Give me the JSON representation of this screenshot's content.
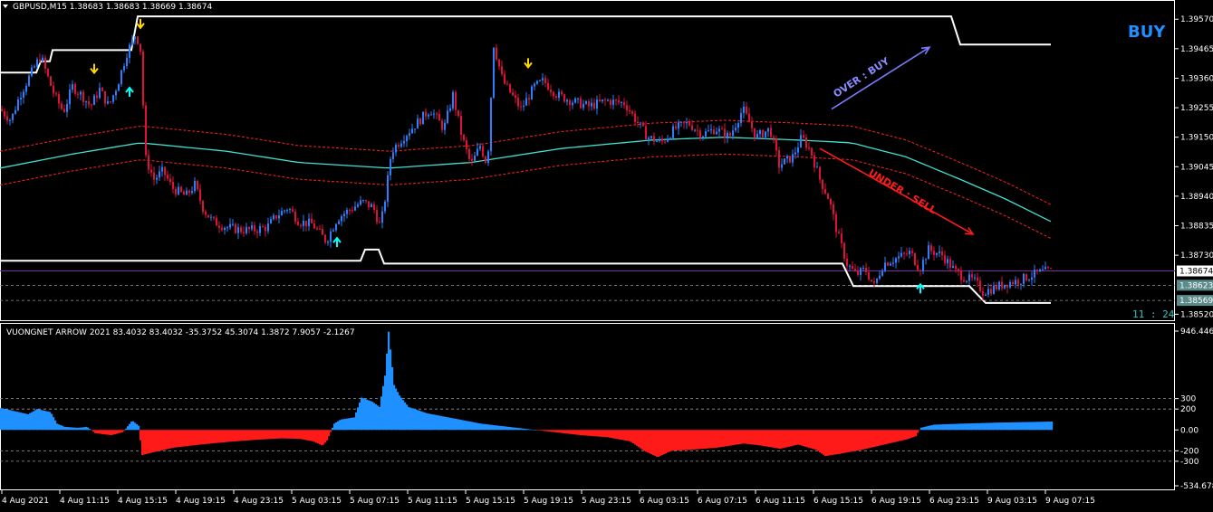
{
  "window": {
    "symbol_header": "GBPUSD,M15  1.38683 1.38683 1.38669 1.38674",
    "signal_label": "BUY",
    "countdown": "11 : 24"
  },
  "indicator": {
    "header": "VUONGNET ARROW 2021  83.4032 83.4032 -35.3752 45.3074 1.3872 7.9057 -2.1267"
  },
  "annotations": {
    "over_buy": "OVER : BUY",
    "under_sell": "UNDER : SELL"
  },
  "colors": {
    "background": "#000000",
    "bull_candle": "#2a7fff",
    "bear_candle": "#e0103a",
    "ma_line": "#40e0d0",
    "band_line": "#ff2020",
    "channel_line": "#ffffff",
    "hist_pos": "#1e90ff",
    "hist_neg": "#ff1a1a",
    "buy_text": "#1e90ff",
    "arrow_over": "#7b7bff",
    "arrow_under": "#ff1a1a",
    "up_arrow": "#00ffff",
    "down_arrow": "#ffd700",
    "current_line": "#7a2aa0"
  },
  "chart_data": [
    {
      "type": "candlestick",
      "symbol": "GBPUSD",
      "timeframe": "M15",
      "title": "GBPUSD,M15",
      "ohlc_last": {
        "open": 1.38683,
        "high": 1.38683,
        "low": 1.38669,
        "close": 1.38674
      },
      "ylim": [
        1.38505,
        1.3959
      ],
      "y_ticks": [
        "1.39570",
        "1.39465",
        "1.39360",
        "1.39255",
        "1.39150",
        "1.39045",
        "1.38940",
        "1.38835",
        "1.38730",
        "1.38520"
      ],
      "y_tick_values": [
        1.3957,
        1.39465,
        1.3936,
        1.39255,
        1.3915,
        1.39045,
        1.3894,
        1.38835,
        1.3873,
        1.3852
      ],
      "price_tags": [
        {
          "label": "1.38674",
          "value": 1.38674,
          "style": "current"
        },
        {
          "label": "1.38623",
          "value": 1.38623,
          "style": "level"
        },
        {
          "label": "1.38569",
          "value": 1.38569,
          "style": "level"
        }
      ],
      "x_ticks": [
        "4 Aug 2021",
        "4 Aug 11:15",
        "4 Aug 15:15",
        "4 Aug 19:15",
        "4 Aug 23:15",
        "5 Aug 03:15",
        "5 Aug 07:15",
        "5 Aug 11:15",
        "5 Aug 15:15",
        "5 Aug 19:15",
        "5 Aug 23:15",
        "6 Aug 03:15",
        "6 Aug 07:15",
        "6 Aug 11:15",
        "6 Aug 15:15",
        "6 Aug 19:15",
        "6 Aug 23:15",
        "9 Aug 03:15",
        "9 Aug 07:15"
      ],
      "close_path": [
        [
          0,
          1.3925
        ],
        [
          12,
          1.3921
        ],
        [
          22,
          1.393
        ],
        [
          30,
          1.3935
        ],
        [
          38,
          1.394
        ],
        [
          45,
          1.3944
        ],
        [
          52,
          1.3937
        ],
        [
          60,
          1.393
        ],
        [
          70,
          1.3924
        ],
        [
          80,
          1.3933
        ],
        [
          90,
          1.393
        ],
        [
          100,
          1.3926
        ],
        [
          110,
          1.3932
        ],
        [
          120,
          1.3926
        ],
        [
          130,
          1.3934
        ],
        [
          140,
          1.3945
        ],
        [
          150,
          1.3952
        ],
        [
          156,
          1.3945
        ],
        [
          160,
          1.3908
        ],
        [
          170,
          1.39
        ],
        [
          180,
          1.3903
        ],
        [
          190,
          1.3897
        ],
        [
          205,
          1.3894
        ],
        [
          215,
          1.3898
        ],
        [
          225,
          1.3889
        ],
        [
          235,
          1.3885
        ],
        [
          250,
          1.3883
        ],
        [
          265,
          1.3882
        ],
        [
          280,
          1.3882
        ],
        [
          295,
          1.3883
        ],
        [
          305,
          1.3887
        ],
        [
          318,
          1.389
        ],
        [
          330,
          1.3885
        ],
        [
          345,
          1.3884
        ],
        [
          360,
          1.3878
        ],
        [
          372,
          1.3886
        ],
        [
          385,
          1.3889
        ],
        [
          400,
          1.3892
        ],
        [
          412,
          1.389
        ],
        [
          420,
          1.3883
        ],
        [
          426,
          1.3895
        ],
        [
          432,
          1.391
        ],
        [
          445,
          1.3915
        ],
        [
          460,
          1.392
        ],
        [
          475,
          1.3925
        ],
        [
          490,
          1.3918
        ],
        [
          500,
          1.393
        ],
        [
          510,
          1.3915
        ],
        [
          520,
          1.3905
        ],
        [
          530,
          1.3912
        ],
        [
          538,
          1.3905
        ],
        [
          545,
          1.3948
        ],
        [
          555,
          1.3935
        ],
        [
          565,
          1.393
        ],
        [
          575,
          1.3925
        ],
        [
          590,
          1.3933
        ],
        [
          600,
          1.3935
        ],
        [
          615,
          1.393
        ],
        [
          630,
          1.3928
        ],
        [
          650,
          1.3926
        ],
        [
          670,
          1.3928
        ],
        [
          690,
          1.3927
        ],
        [
          700,
          1.3922
        ],
        [
          715,
          1.3915
        ],
        [
          730,
          1.3913
        ],
        [
          745,
          1.3918
        ],
        [
          760,
          1.392
        ],
        [
          775,
          1.3916
        ],
        [
          790,
          1.3918
        ],
        [
          805,
          1.3915
        ],
        [
          820,
          1.3925
        ],
        [
          835,
          1.3915
        ],
        [
          850,
          1.3918
        ],
        [
          860,
          1.3905
        ],
        [
          875,
          1.3908
        ],
        [
          885,
          1.3915
        ],
        [
          895,
          1.391
        ],
        [
          905,
          1.39
        ],
        [
          915,
          1.3893
        ],
        [
          925,
          1.388
        ],
        [
          935,
          1.387
        ],
        [
          945,
          1.3866
        ],
        [
          955,
          1.3868
        ],
        [
          965,
          1.3862
        ],
        [
          975,
          1.387
        ],
        [
          990,
          1.3872
        ],
        [
          1005,
          1.3874
        ],
        [
          1015,
          1.3868
        ],
        [
          1025,
          1.3875
        ],
        [
          1040,
          1.3873
        ],
        [
          1055,
          1.3867
        ],
        [
          1065,
          1.3865
        ],
        [
          1075,
          1.3864
        ],
        [
          1085,
          1.386
        ],
        [
          1095,
          1.3861
        ],
        [
          1110,
          1.3863
        ],
        [
          1125,
          1.3864
        ],
        [
          1140,
          1.3866
        ],
        [
          1150,
          1.3867
        ],
        [
          1160,
          1.38674
        ]
      ],
      "moving_average": [
        [
          0,
          1.3904
        ],
        [
          80,
          1.3909
        ],
        [
          155,
          1.3913
        ],
        [
          250,
          1.391
        ],
        [
          330,
          1.3906
        ],
        [
          430,
          1.3904
        ],
        [
          520,
          1.3906
        ],
        [
          620,
          1.3911
        ],
        [
          720,
          1.3914
        ],
        [
          800,
          1.3915
        ],
        [
          880,
          1.3914
        ],
        [
          940,
          1.3913
        ],
        [
          1000,
          1.3908
        ],
        [
          1060,
          1.39
        ],
        [
          1110,
          1.3893
        ],
        [
          1160,
          1.3885
        ]
      ],
      "band_offset": 0.0006,
      "channel_upper": [
        [
          0,
          1.3938
        ],
        [
          40,
          1.3938
        ],
        [
          45,
          1.3942
        ],
        [
          55,
          1.3942
        ],
        [
          58,
          1.3946
        ],
        [
          145,
          1.3946
        ],
        [
          152,
          1.3958
        ],
        [
          1050,
          1.3958
        ],
        [
          1060,
          1.3948
        ],
        [
          1160,
          1.3948
        ]
      ],
      "channel_lower": [
        [
          0,
          1.3871
        ],
        [
          398,
          1.3871
        ],
        [
          403,
          1.3875
        ],
        [
          418,
          1.3875
        ],
        [
          424,
          1.387
        ],
        [
          930,
          1.387
        ],
        [
          942,
          1.3862
        ],
        [
          1070,
          1.3862
        ],
        [
          1088,
          1.3856
        ],
        [
          1160,
          1.3856
        ]
      ],
      "signals": [
        {
          "type": "sell_arrow",
          "x": 104,
          "price": 1.39395
        },
        {
          "type": "buy_arrow",
          "x": 143,
          "price": 1.3931
        },
        {
          "type": "sell_arrow",
          "x": 155,
          "price": 1.39555
        },
        {
          "type": "buy_arrow",
          "x": 372,
          "price": 1.38775
        },
        {
          "type": "sell_arrow",
          "x": 583,
          "price": 1.39415
        },
        {
          "type": "buy_arrow",
          "x": 1016,
          "price": 1.3861
        }
      ],
      "trend_arrows": [
        {
          "name": "OVER : BUY",
          "from": [
            918,
            1.3925
          ],
          "to": [
            1026,
            1.3947
          ]
        },
        {
          "name": "UNDER : SELL",
          "from": [
            905,
            1.3911
          ],
          "to": [
            1074,
            1.38805
          ]
        }
      ]
    },
    {
      "type": "histogram",
      "title": "VUONGNET ARROW 2021",
      "ylim": [
        -534.6788,
        946.4467
      ],
      "y_ticks": [
        "946.4467",
        "300",
        "200",
        "0.00",
        "-200",
        "-300",
        "-534.6788"
      ],
      "y_tick_values": [
        946.4467,
        300,
        200,
        0,
        -200,
        -300,
        -534.6788
      ],
      "reference_levels": [
        300,
        200,
        -200,
        -300
      ],
      "values_path": [
        [
          0,
          210
        ],
        [
          15,
          180
        ],
        [
          30,
          150
        ],
        [
          40,
          200
        ],
        [
          55,
          170
        ],
        [
          62,
          60
        ],
        [
          70,
          30
        ],
        [
          85,
          20
        ],
        [
          95,
          30
        ],
        [
          104,
          -30
        ],
        [
          112,
          -40
        ],
        [
          122,
          -50
        ],
        [
          135,
          -20
        ],
        [
          145,
          90
        ],
        [
          152,
          40
        ],
        [
          156,
          -240
        ],
        [
          170,
          -210
        ],
        [
          190,
          -170
        ],
        [
          220,
          -140
        ],
        [
          250,
          -115
        ],
        [
          280,
          -95
        ],
        [
          310,
          -80
        ],
        [
          330,
          -85
        ],
        [
          345,
          -110
        ],
        [
          355,
          -150
        ],
        [
          360,
          -100
        ],
        [
          368,
          60
        ],
        [
          375,
          100
        ],
        [
          390,
          120
        ],
        [
          398,
          310
        ],
        [
          410,
          270
        ],
        [
          418,
          220
        ],
        [
          424,
          520
        ],
        [
          428,
          940
        ],
        [
          434,
          430
        ],
        [
          440,
          330
        ],
        [
          450,
          220
        ],
        [
          470,
          160
        ],
        [
          500,
          110
        ],
        [
          530,
          60
        ],
        [
          560,
          30
        ],
        [
          590,
          0
        ],
        [
          610,
          -20
        ],
        [
          640,
          -50
        ],
        [
          670,
          -70
        ],
        [
          695,
          -110
        ],
        [
          710,
          -200
        ],
        [
          725,
          -260
        ],
        [
          740,
          -200
        ],
        [
          760,
          -190
        ],
        [
          790,
          -170
        ],
        [
          820,
          -130
        ],
        [
          840,
          -150
        ],
        [
          860,
          -180
        ],
        [
          880,
          -140
        ],
        [
          900,
          -190
        ],
        [
          910,
          -250
        ],
        [
          925,
          -230
        ],
        [
          950,
          -190
        ],
        [
          980,
          -130
        ],
        [
          1000,
          -90
        ],
        [
          1010,
          -60
        ],
        [
          1015,
          20
        ],
        [
          1030,
          50
        ],
        [
          1060,
          60
        ],
        [
          1100,
          70
        ],
        [
          1130,
          75
        ],
        [
          1160,
          80
        ]
      ]
    }
  ]
}
